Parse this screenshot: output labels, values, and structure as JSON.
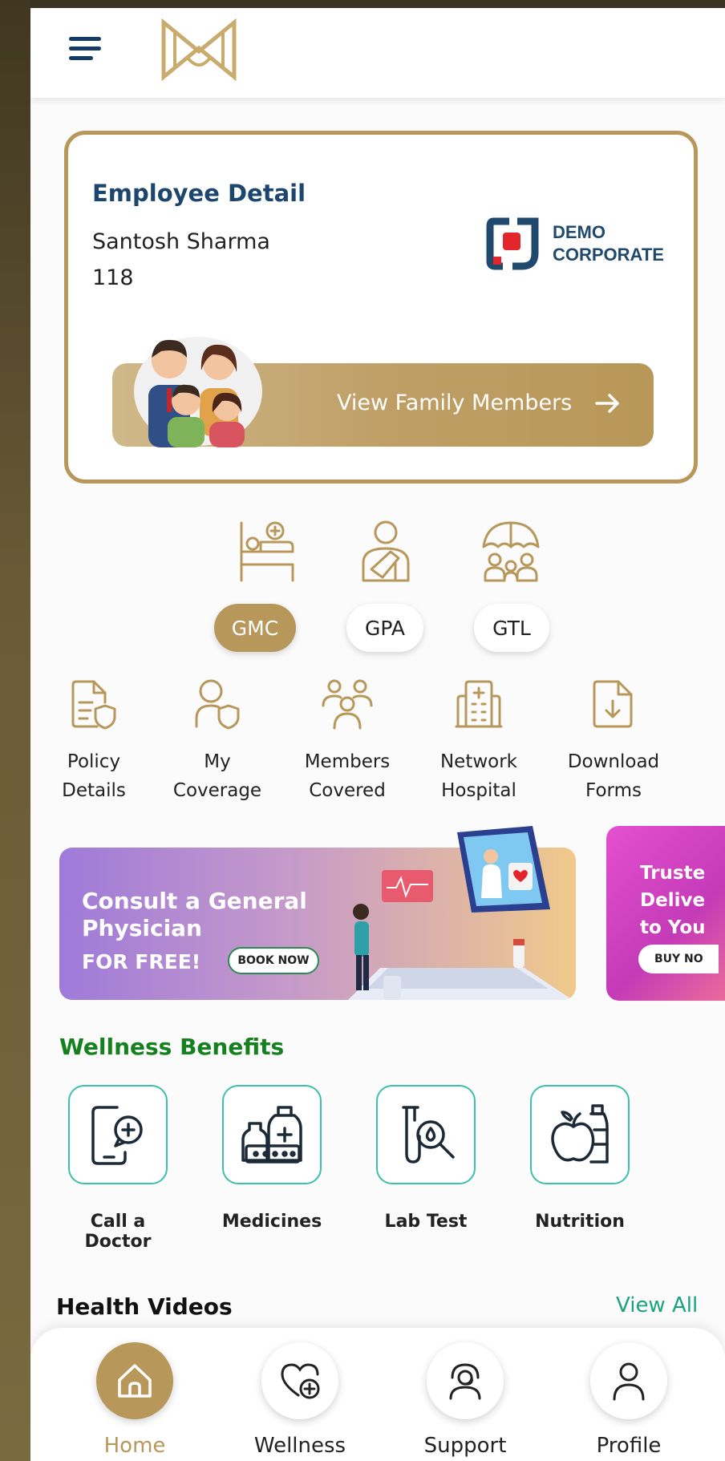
{
  "employee": {
    "title": "Employee Detail",
    "name": "Santosh Sharma",
    "id": "118",
    "company_line1": "DEMO",
    "company_line2": "CORPORATE",
    "family_button": "View Family Members"
  },
  "policy_tabs": [
    {
      "label": "GMC",
      "icon": "hospital-bed-icon",
      "active": true
    },
    {
      "label": "GPA",
      "icon": "injured-person-icon",
      "active": false
    },
    {
      "label": "GTL",
      "icon": "umbrella-family-icon",
      "active": false
    }
  ],
  "quick_actions": [
    {
      "line1": "Policy",
      "line2": "Details",
      "icon": "policy-shield-icon"
    },
    {
      "line1": "My",
      "line2": "Coverage",
      "icon": "user-shield-icon"
    },
    {
      "line1": "Members",
      "line2": "Covered",
      "icon": "group-icon"
    },
    {
      "line1": "Network",
      "line2": "Hospital",
      "icon": "hospital-building-icon"
    },
    {
      "line1": "Download",
      "line2": "Forms",
      "icon": "download-file-icon"
    }
  ],
  "banners": {
    "consult": {
      "line1": "Consult a General",
      "line2": "Physician",
      "line3": "FOR FREE!",
      "button": "BOOK NOW"
    },
    "second": {
      "line1": "Truste",
      "line2": "Delive",
      "line3": "to You",
      "button": "BUY NO"
    }
  },
  "wellness": {
    "title": "Wellness Benefits",
    "items": [
      {
        "label": "Call a Doctor",
        "icon": "phone-medical-icon"
      },
      {
        "label": "Medicines",
        "icon": "medicine-bottles-icon"
      },
      {
        "label": "Lab Test",
        "icon": "test-tube-search-icon"
      },
      {
        "label": "Nutrition",
        "icon": "apple-bottle-icon"
      }
    ]
  },
  "health_videos": {
    "title": "Health Videos",
    "view_all": "View All"
  },
  "bottom_nav": [
    {
      "label": "Home",
      "icon": "home-icon",
      "active": true
    },
    {
      "label": "Wellness",
      "icon": "heart-plus-icon",
      "active": false
    },
    {
      "label": "Support",
      "icon": "support-headset-icon",
      "active": false
    },
    {
      "label": "Profile",
      "icon": "user-icon",
      "active": false
    }
  ],
  "colors": {
    "gold": "#b8975b",
    "navy": "#1d466f",
    "green": "#15801e",
    "teal": "#3cc0ab"
  }
}
